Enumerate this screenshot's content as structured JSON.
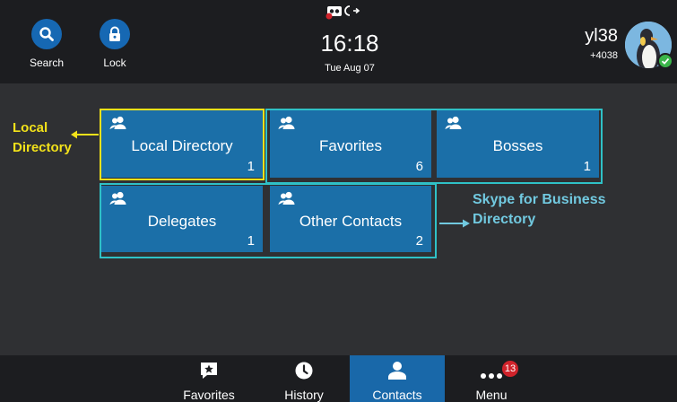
{
  "header": {
    "search_label": "Search",
    "lock_label": "Lock",
    "time": "16:18",
    "date": "Tue Aug 07",
    "user_name": "yl38",
    "user_extension": "+4038",
    "status_icons": [
      "voicemail-icon",
      "call-forward-icon"
    ],
    "presence": "available"
  },
  "tiles": [
    {
      "label": "Local Directory",
      "count": "1",
      "icon": "contact-group-icon"
    },
    {
      "label": "Favorites",
      "count": "6",
      "icon": "contact-group-icon"
    },
    {
      "label": "Bosses",
      "count": "1",
      "icon": "contact-group-icon"
    },
    {
      "label": "Delegates",
      "count": "1",
      "icon": "contact-group-icon"
    },
    {
      "label": "Other Contacts",
      "count": "2",
      "icon": "contact-group-icon"
    }
  ],
  "annotations": {
    "local_line1": "Local",
    "local_line2": "Directory",
    "sfb_line1": "Skype for Business",
    "sfb_line2": "Directory"
  },
  "nav": {
    "favorites": "Favorites",
    "history": "History",
    "contacts": "Contacts",
    "menu": "Menu",
    "menu_badge": "13",
    "active": "Contacts"
  },
  "colors": {
    "tile": "#1b6fa8",
    "accent": "#1668b3",
    "local_outline": "#f3e21a",
    "sfb_outline": "#2fc1c7",
    "badge": "#d0232b"
  }
}
